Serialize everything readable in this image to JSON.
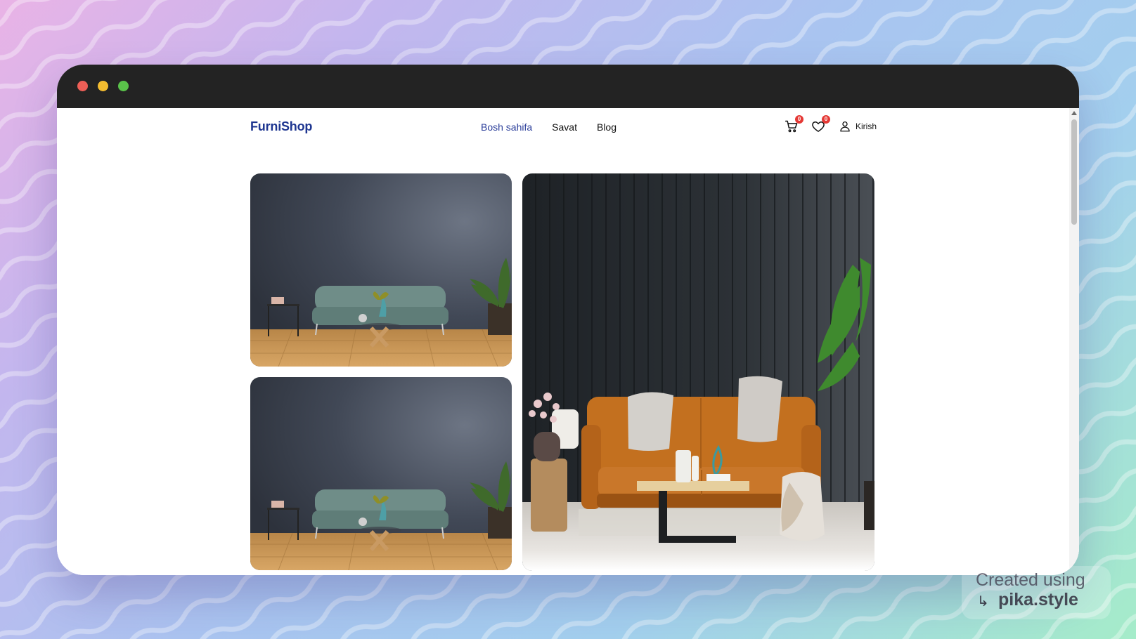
{
  "brand": {
    "name": "FurniShop"
  },
  "nav": {
    "links": [
      "Bosh sahifa",
      "Savat",
      "Blog"
    ],
    "active_index": 0
  },
  "header_actions": {
    "cart_count": "0",
    "wishlist_count": "0",
    "login_label": "Kirish"
  },
  "gallery": {
    "images": [
      {
        "name": "living-room-gray-sofa"
      },
      {
        "name": "living-room-gray-sofa"
      },
      {
        "name": "living-room-orange-sofa"
      }
    ]
  },
  "watermark": {
    "line1": "Created using",
    "line2": "pika.style"
  },
  "colors": {
    "brand": "#1d3590",
    "active_link": "#2b3e9a",
    "badge": "#e53935",
    "titlebar": "#232323"
  }
}
